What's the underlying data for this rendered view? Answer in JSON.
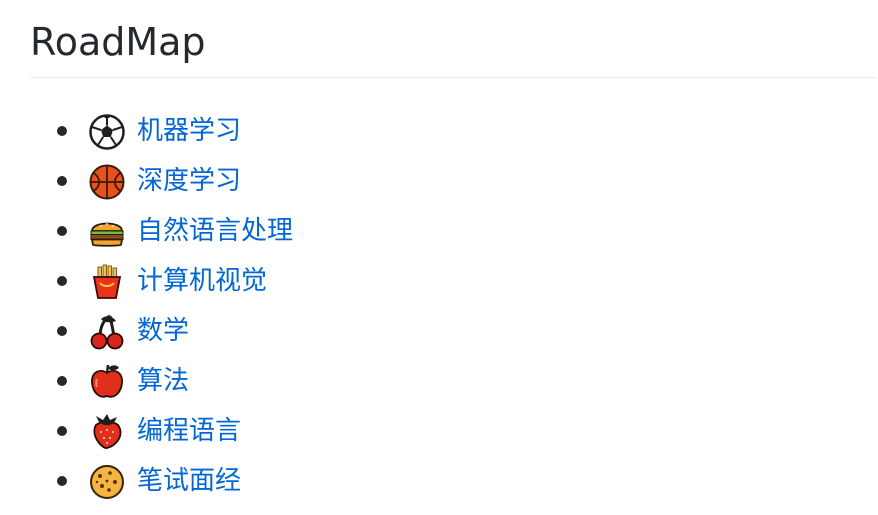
{
  "heading": "RoadMap",
  "colors": {
    "link": "#0366d6",
    "text": "#24292e",
    "rule": "#eaecef"
  },
  "items": [
    {
      "label": "机器学习",
      "icon": "soccer-ball-icon"
    },
    {
      "label": "深度学习",
      "icon": "basketball-icon"
    },
    {
      "label": "自然语言处理",
      "icon": "hamburger-icon"
    },
    {
      "label": "计算机视觉",
      "icon": "french-fries-icon"
    },
    {
      "label": "数学",
      "icon": "cherries-icon"
    },
    {
      "label": "算法",
      "icon": "apple-icon"
    },
    {
      "label": "编程语言",
      "icon": "strawberry-icon"
    },
    {
      "label": "笔试面经",
      "icon": "cookie-icon"
    }
  ]
}
